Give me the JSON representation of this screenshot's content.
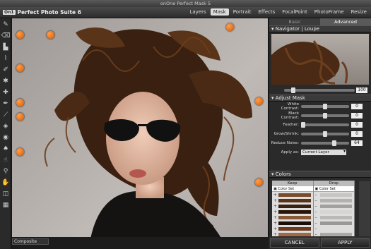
{
  "window": {
    "title": "onOne Perfect Mask 5"
  },
  "app": {
    "name": "Perfect Photo Suite 6",
    "logo": "On1"
  },
  "topmenu": [
    {
      "label": "Layers",
      "active": false
    },
    {
      "label": "Mask",
      "active": true
    },
    {
      "label": "Portrait",
      "active": false
    },
    {
      "label": "Effects",
      "active": false
    },
    {
      "label": "FocalPoint",
      "active": false
    },
    {
      "label": "PhotoFrame",
      "active": false
    },
    {
      "label": "Resize",
      "active": false
    }
  ],
  "tools": [
    "brush-icon",
    "eraser-icon",
    "stamp-icon",
    "dropper-icon",
    "magic-brush-icon",
    "drop-tool-icon",
    "keep-tool-icon",
    "pen-icon",
    "chisel-icon",
    "blur-icon",
    "fill-icon",
    "bucket-icon",
    "refine-icon",
    "zoom-icon",
    "hand-icon",
    "compare-icon",
    "grid-icon"
  ],
  "panel": {
    "tabs": [
      {
        "label": "Basic",
        "active": false
      },
      {
        "label": "Advanced",
        "active": true
      }
    ],
    "navigator": {
      "title": "Navigator",
      "loupe": "Loupe",
      "zoom": "100"
    },
    "adjust_mask": {
      "title": "Adjust Mask",
      "rows": [
        {
          "label": "White Contrast:",
          "value": "0"
        },
        {
          "label": "Black Contrast:",
          "value": "0"
        },
        {
          "label": "Feather:",
          "value": "0"
        },
        {
          "label": "Grow/Shrink:",
          "value": "0"
        },
        {
          "label": "Reduce Noise:",
          "value": "64"
        }
      ],
      "apply_as": {
        "label": "Apply as:",
        "value": "Current Layer"
      }
    },
    "colors": {
      "title": "Colors",
      "keep_label": "Keep",
      "drop_label": "Drop",
      "set_label": "Color Set"
    }
  },
  "status": {
    "composite": "Composite"
  },
  "buttons": {
    "cancel": "CANCEL",
    "apply": "APPLY"
  },
  "colors_theme": {
    "accent_orange": "#e06400"
  }
}
